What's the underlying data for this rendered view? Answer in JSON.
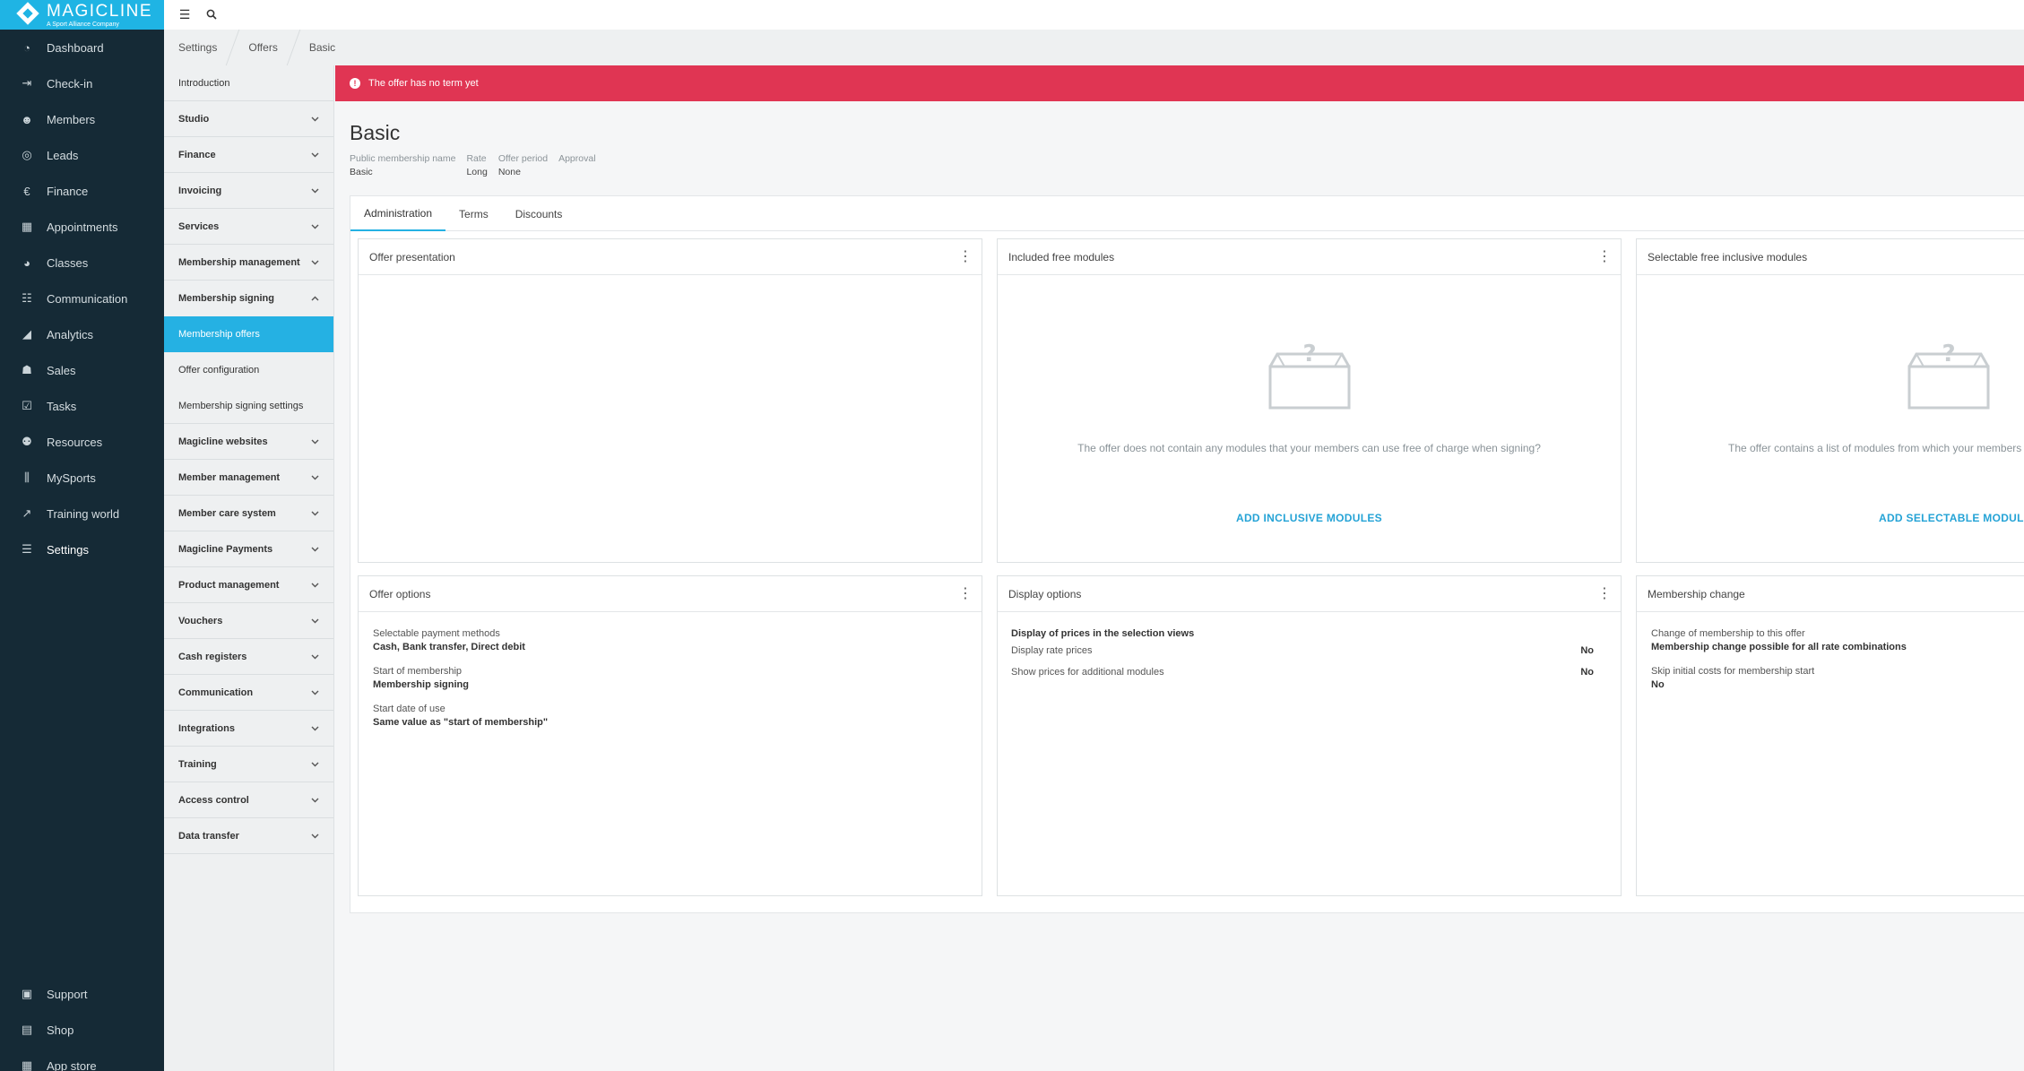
{
  "brand": {
    "name": "MAGICLINE",
    "tagline": "A Sport Alliance Company",
    "accent": "#1fb4e4"
  },
  "nav": {
    "items": [
      {
        "label": "Dashboard",
        "icon": "gauge-icon"
      },
      {
        "label": "Check-in",
        "icon": "check-in-icon"
      },
      {
        "label": "Members",
        "icon": "members-icon"
      },
      {
        "label": "Leads",
        "icon": "leads-icon"
      },
      {
        "label": "Finance",
        "icon": "finance-icon"
      },
      {
        "label": "Appointments",
        "icon": "calendar-icon"
      },
      {
        "label": "Classes",
        "icon": "classes-icon"
      },
      {
        "label": "Communication",
        "icon": "chat-icon"
      },
      {
        "label": "Analytics",
        "icon": "chart-icon"
      },
      {
        "label": "Sales",
        "icon": "cart-icon"
      },
      {
        "label": "Tasks",
        "icon": "checkbox-icon"
      },
      {
        "label": "Resources",
        "icon": "resources-icon"
      },
      {
        "label": "MySports",
        "icon": "mysports-icon"
      },
      {
        "label": "Training world",
        "icon": "training-icon"
      },
      {
        "label": "Settings",
        "icon": "sliders-icon"
      }
    ],
    "bottom": [
      {
        "label": "Support",
        "icon": "support-icon"
      },
      {
        "label": "Shop",
        "icon": "shop-icon"
      },
      {
        "label": "App store",
        "icon": "grid-icon"
      }
    ]
  },
  "breadcrumb": [
    "Settings",
    "Offers",
    "Basic"
  ],
  "submenu": {
    "intro": "Introduction",
    "groups_top": [
      "Studio",
      "Finance",
      "Invoicing",
      "Services",
      "Membership management"
    ],
    "expanded": "Membership signing",
    "children": [
      "Membership offers",
      "Offer configuration",
      "Membership signing settings"
    ],
    "groups_bottom": [
      "Magicline websites",
      "Member management",
      "Member care system",
      "Magicline Payments",
      "Product management",
      "Vouchers",
      "Cash registers",
      "Communication",
      "Integrations",
      "Training",
      "Access control",
      "Data transfer"
    ]
  },
  "alert": {
    "text": "The offer has no term yet",
    "color": "#e03553"
  },
  "offer": {
    "title": "Basic",
    "meta": [
      {
        "label": "Public membership name",
        "value": "Basic"
      },
      {
        "label": "Rate",
        "value": "Long"
      },
      {
        "label": "Offer period",
        "value": "None"
      },
      {
        "label": "Approval",
        "value": ""
      }
    ]
  },
  "tabs": [
    "Administration",
    "Terms",
    "Discounts"
  ],
  "cards": {
    "presentation": {
      "title": "Offer presentation"
    },
    "included": {
      "title": "Included free modules",
      "empty": "The offer does not contain any modules that your members can use free of charge when signing?",
      "action": "ADD INCLUSIVE MODULES"
    },
    "selectable": {
      "title": "Selectable free inclusive modules",
      "empty": "The offer contains a list of modules from which your members",
      "action": "ADD SELECTABLE MODULES"
    },
    "options": {
      "title": "Offer options",
      "fields": [
        {
          "label": "Selectable payment methods",
          "value": "Cash, Bank transfer, Direct debit"
        },
        {
          "label": "Start of membership",
          "value": "Membership signing"
        },
        {
          "label": "Start date of use",
          "value": "Same value as \"start of membership\""
        }
      ]
    },
    "display": {
      "title": "Display options",
      "heading": "Display of prices in the selection views",
      "rows": [
        {
          "label": "Display rate prices",
          "value": "No"
        },
        {
          "label": "Show prices for additional modules",
          "value": "No"
        }
      ]
    },
    "change": {
      "title": "Membership change",
      "fields": [
        {
          "label": "Change of membership to this offer",
          "value": "Membership change possible for all rate combinations"
        },
        {
          "label": "Skip initial costs for membership start",
          "value": "No"
        }
      ]
    }
  }
}
